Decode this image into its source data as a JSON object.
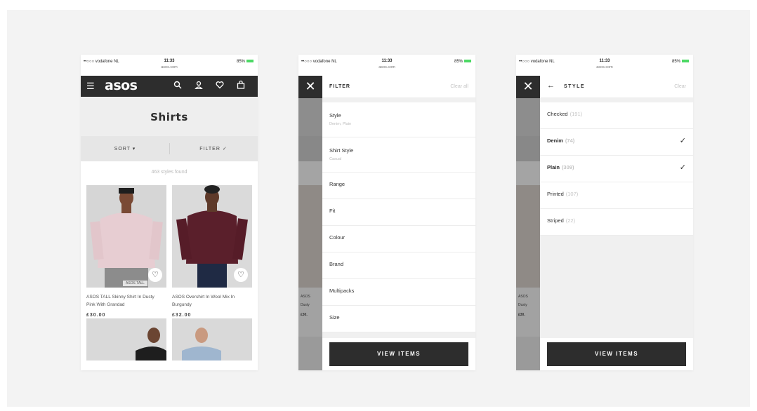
{
  "status": {
    "carrier": "••○○○ vodafone NL",
    "time": "11:33",
    "url": "asos.com",
    "battery": "85%"
  },
  "browse": {
    "logo": "asos",
    "title": "Shirts",
    "sort_label": "SORT ▾",
    "filter_label": "FILTER ✓",
    "count": "463 styles found",
    "products": [
      {
        "name": "ASOS TALL Skinny Shirt In Dusty Pink With Grandad",
        "price": "£30.00",
        "tag": "ASOS TALL"
      },
      {
        "name": "ASOS Overshirt In Wool Mix In Burgundy",
        "price": "£32.00"
      }
    ]
  },
  "filter": {
    "title": "FILTER",
    "clear_all": "Clear all",
    "items": [
      {
        "label": "Style",
        "sub": "Denim, Plain"
      },
      {
        "label": "Shirt Style",
        "sub": "Casual"
      },
      {
        "label": "Range"
      },
      {
        "label": "Fit"
      },
      {
        "label": "Colour"
      },
      {
        "label": "Brand"
      },
      {
        "label": "Multipacks"
      },
      {
        "label": "Size"
      }
    ],
    "view_items": "VIEW ITEMS"
  },
  "style": {
    "title": "STYLE",
    "clear": "Clear",
    "items": [
      {
        "label": "Checked",
        "count": "(191)",
        "selected": false
      },
      {
        "label": "Denim",
        "count": "(74)",
        "selected": true
      },
      {
        "label": "Plain",
        "count": "(309)",
        "selected": true
      },
      {
        "label": "Printed",
        "count": "(107)",
        "selected": false
      },
      {
        "label": "Striped",
        "count": "(22)",
        "selected": false
      }
    ],
    "view_items": "VIEW ITEMS"
  },
  "ghost_text": {
    "a": "ASOS",
    "b": "Dusty",
    "c": "£30."
  },
  "colors": {
    "dark": "#2d2d2d",
    "background": "#f3f3f3",
    "battery": "#4cd964"
  }
}
